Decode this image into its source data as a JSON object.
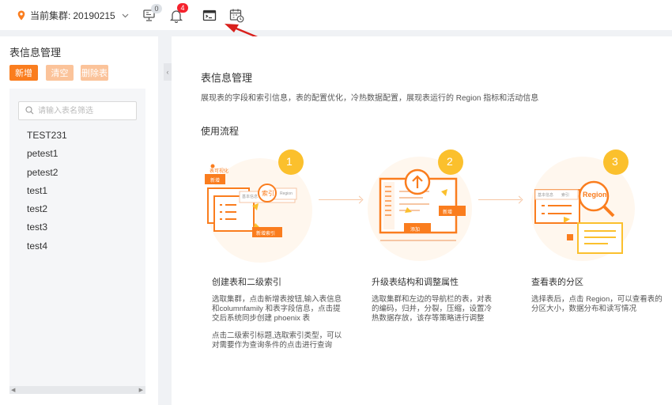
{
  "topbar": {
    "cluster_label": "当前集群:",
    "cluster_value": "20190215",
    "monitor_badge": "0",
    "bell_badge": "4",
    "icons": [
      "location-pin-icon",
      "chevron-down-icon",
      "monitor-icon",
      "bell-icon",
      "terminal-icon",
      "calendar-clock-icon"
    ]
  },
  "sidebar": {
    "title": "表信息管理",
    "add_label": "新增",
    "clear_label": "清空",
    "delete_label": "删除表",
    "search_placeholder": "请输入表名筛选",
    "tables": [
      "TEST231",
      "petest1",
      "petest2",
      "test1",
      "test2",
      "test3",
      "test4"
    ]
  },
  "main": {
    "title": "表信息管理",
    "description": "展现表的字段和索引信息，表的配置优化，冷热数据配置，展现表运行的 Region 指标和活动信息",
    "flow_title": "使用流程",
    "steps": [
      {
        "number": "1",
        "title": "创建表和二级索引",
        "text1": "选取集群，点击新增表按钮,输入表信息和columnfamily 和表字段信息，点击提交后系统同步创建 phoenix 表",
        "text2": "点击二级索引标题,选取索引类型，可以对需要作为查询条件的点击进行查询",
        "ill": {
          "tag": "表可视化",
          "add": "新增",
          "index": "索引",
          "basic": "基本信息",
          "region": "Region",
          "new_index": "新增索引"
        }
      },
      {
        "number": "2",
        "title": "升级表结构和调整属性",
        "text1": "选取集群和左边的导航栏的表，对表的编码，归并，分裂，压缩，设置冷热数据存放，该存等策略进行调整",
        "ill": {
          "add": "新增",
          "append": "添加"
        }
      },
      {
        "number": "3",
        "title": "查看表的分区",
        "text1": "选择表后，点击 Region，可以查看表的分区大小，数据分布和读写情况",
        "ill": {
          "basic": "基本信息",
          "index": "索引",
          "region": "Region"
        }
      }
    ]
  },
  "colors": {
    "accent": "#fa7d1e",
    "accent_light": "#fbc39a",
    "badge_red": "#f5222d",
    "step_yellow": "#fbc02d",
    "annotation_red": "#d9201c"
  }
}
